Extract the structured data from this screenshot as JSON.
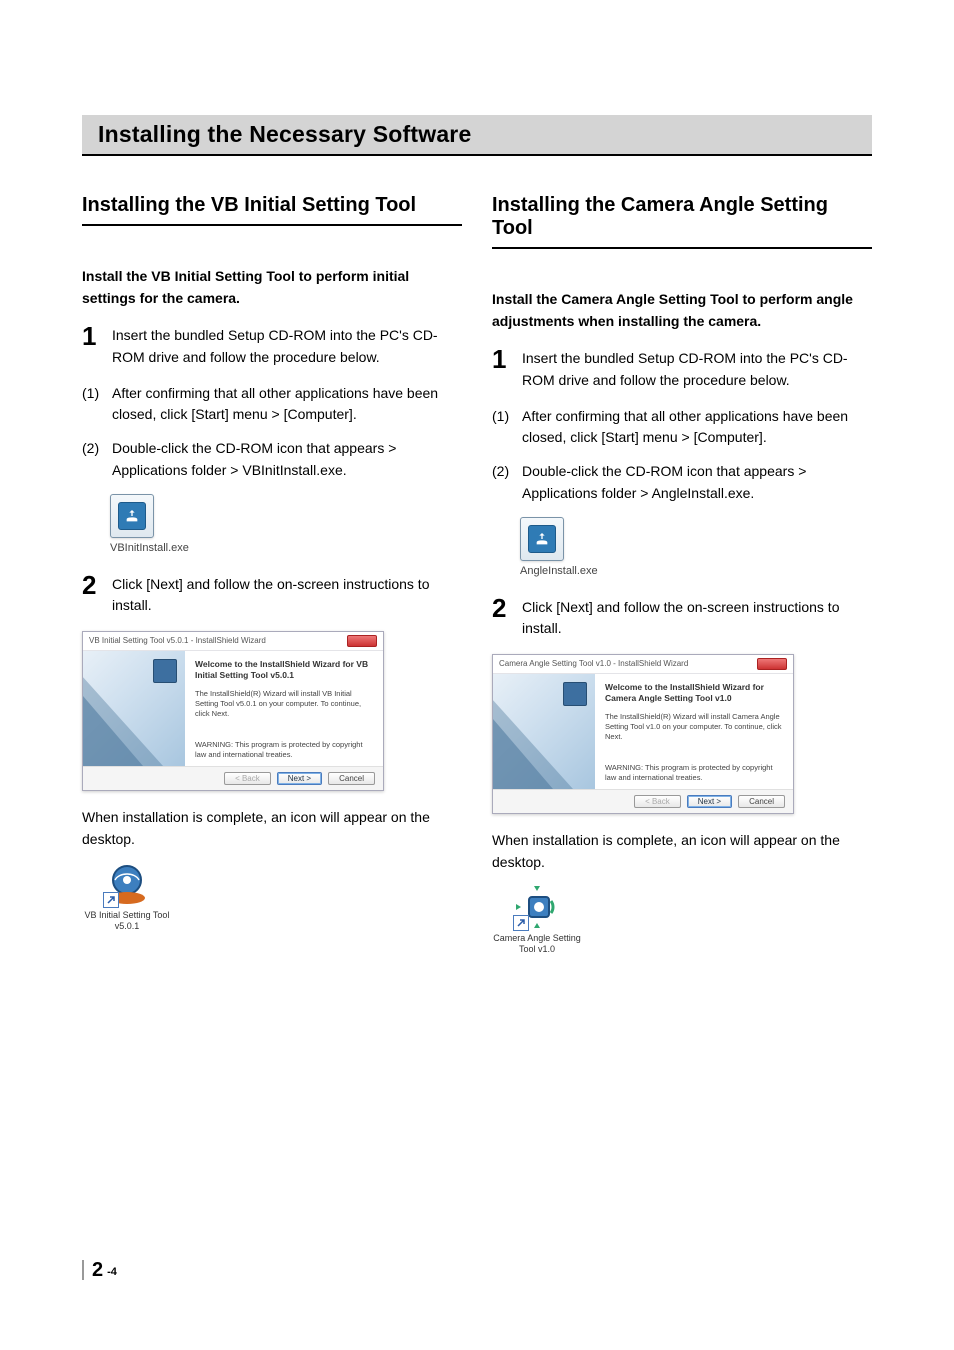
{
  "main_title": "Installing the Necessary Software",
  "left": {
    "title": "Installing the VB Initial Setting Tool",
    "lead": "Install the VB Initial Setting Tool to perform initial settings for the camera.",
    "step1": "Insert the bundled Setup CD-ROM into the PC's CD-ROM drive and follow the procedure below.",
    "sub1_lbl": "(1)",
    "sub1": "After confirming that all other applications have been closed, click [Start] menu > [Computer].",
    "sub2_lbl": "(2)",
    "sub2": "Double-click the CD-ROM icon that appears > Applications folder > VBInitInstall.exe.",
    "exe_label": "VBInitInstall.exe",
    "step2": "Click [Next] and follow the on-screen instructions to install.",
    "wizard": {
      "title": "VB Initial Setting Tool v5.0.1 - InstallShield Wizard",
      "heading": "Welcome to the InstallShield Wizard for VB Initial Setting Tool v5.0.1",
      "body": "The InstallShield(R) Wizard will install VB Initial Setting Tool v5.0.1 on your computer. To continue, click Next.",
      "warn": "WARNING: This program is protected by copyright law and international treaties.",
      "back": "< Back",
      "next": "Next >",
      "cancel": "Cancel"
    },
    "post": "When installation is complete, an icon will appear on the desktop.",
    "desk_label": "VB Initial Setting Tool v5.0.1"
  },
  "right": {
    "title": "Installing the Camera Angle Setting Tool",
    "lead": "Install the Camera Angle Setting Tool to perform angle adjustments when installing the camera.",
    "step1": "Insert the bundled Setup CD-ROM into the PC's CD-ROM drive and follow the procedure below.",
    "sub1_lbl": "(1)",
    "sub1": "After confirming that all other applications have been closed, click [Start] menu > [Computer].",
    "sub2_lbl": "(2)",
    "sub2": "Double-click the CD-ROM icon that appears > Applications folder > AngleInstall.exe.",
    "exe_label": "AngleInstall.exe",
    "step2": "Click [Next] and follow the on-screen instructions to install.",
    "wizard": {
      "title": "Camera Angle Setting Tool v1.0 - InstallShield Wizard",
      "heading": "Welcome to the InstallShield Wizard for Camera Angle Setting Tool v1.0",
      "body": "The InstallShield(R) Wizard will install Camera Angle Setting Tool v1.0 on your computer. To continue, click Next.",
      "warn": "WARNING: This program is protected by copyright law and international treaties.",
      "back": "< Back",
      "next": "Next >",
      "cancel": "Cancel"
    },
    "post": "When installation is complete, an icon will appear on the desktop.",
    "desk_label": "Camera Angle Setting Tool v1.0"
  },
  "step_num_1": "1",
  "step_num_2": "2",
  "footer": {
    "chapter": "2",
    "page": "-4"
  }
}
